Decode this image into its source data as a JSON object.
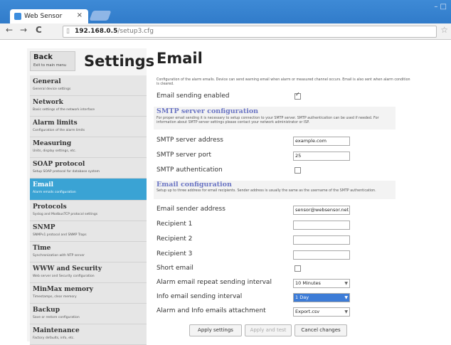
{
  "browser": {
    "tab_title": "Web Sensor",
    "tab_close": "×",
    "url_host": "192.168.0.5",
    "url_path": "/setup3.cfg",
    "nav_back": "←",
    "nav_forward": "→",
    "nav_reload": "C",
    "star": "☆",
    "window_min": "–  □"
  },
  "sidebar": {
    "back": {
      "label": "Back",
      "sub": "Exit to main menu"
    },
    "title": "Settings",
    "items": [
      {
        "label": "General",
        "sub": "General device settings"
      },
      {
        "label": "Network",
        "sub": "Basic settings of the network interface"
      },
      {
        "label": "Alarm limits",
        "sub": "Configuration of the alarm limits"
      },
      {
        "label": "Measuring",
        "sub": "Units, display settings, etc."
      },
      {
        "label": "SOAP protocol",
        "sub": "Setup SOAP protocol for database system"
      },
      {
        "label": "Email",
        "sub": "Alarm emails configuration"
      },
      {
        "label": "Protocols",
        "sub": "Syslog and ModbusTCP protocol settings"
      },
      {
        "label": "SNMP",
        "sub": "SNMPv1 protocol and SNMP Traps"
      },
      {
        "label": "Time",
        "sub": "Synchronization with NTP server"
      },
      {
        "label": "WWW and Security",
        "sub": "Web server and Security configuration"
      },
      {
        "label": "MinMax memory",
        "sub": "Timestamps, clear memory"
      },
      {
        "label": "Backup",
        "sub": "Save or restore configuration"
      },
      {
        "label": "Maintenance",
        "sub": "Factory defaults, info, etc."
      }
    ]
  },
  "main": {
    "title": "Email",
    "description": "Configuration of the alarm emails. Device can send warning email when alarm or measured channel occurs. Email is also sent when alarm condition is cleared.",
    "email_enabled_label": "Email sending enabled",
    "smtp": {
      "title": "SMTP server configuration",
      "description": "For proper email sending it is necessary to setup connection to your SMTP server. SMTP authentication can be used if needed. For information about SMTP server settings please contact your network administrator or ISP.",
      "address_label": "SMTP server address",
      "address_value": "example.com",
      "port_label": "SMTP server port",
      "port_value": "25",
      "auth_label": "SMTP authentication"
    },
    "email_config": {
      "title": "Email configuration",
      "description": "Setup up to three address for email recipients. Sender address is usually the same as the username of the SMTP authentication.",
      "sender_label": "Email sender address",
      "sender_value": "sensor@websensor.net",
      "recipient1_label": "Recipient 1",
      "recipient2_label": "Recipient 2",
      "recipient3_label": "Recipient 3",
      "short_label": "Short email",
      "repeat_label": "Alarm email repeat sending interval",
      "repeat_value": "10 Minutes",
      "info_label": "Info email sending interval",
      "info_value": "1 Day",
      "attach_label": "Alarm and Info emails attachment",
      "attach_value": "Export.csv"
    },
    "buttons": {
      "apply": "Apply settings",
      "apply_test": "Apply and test",
      "cancel": "Cancel changes"
    }
  }
}
